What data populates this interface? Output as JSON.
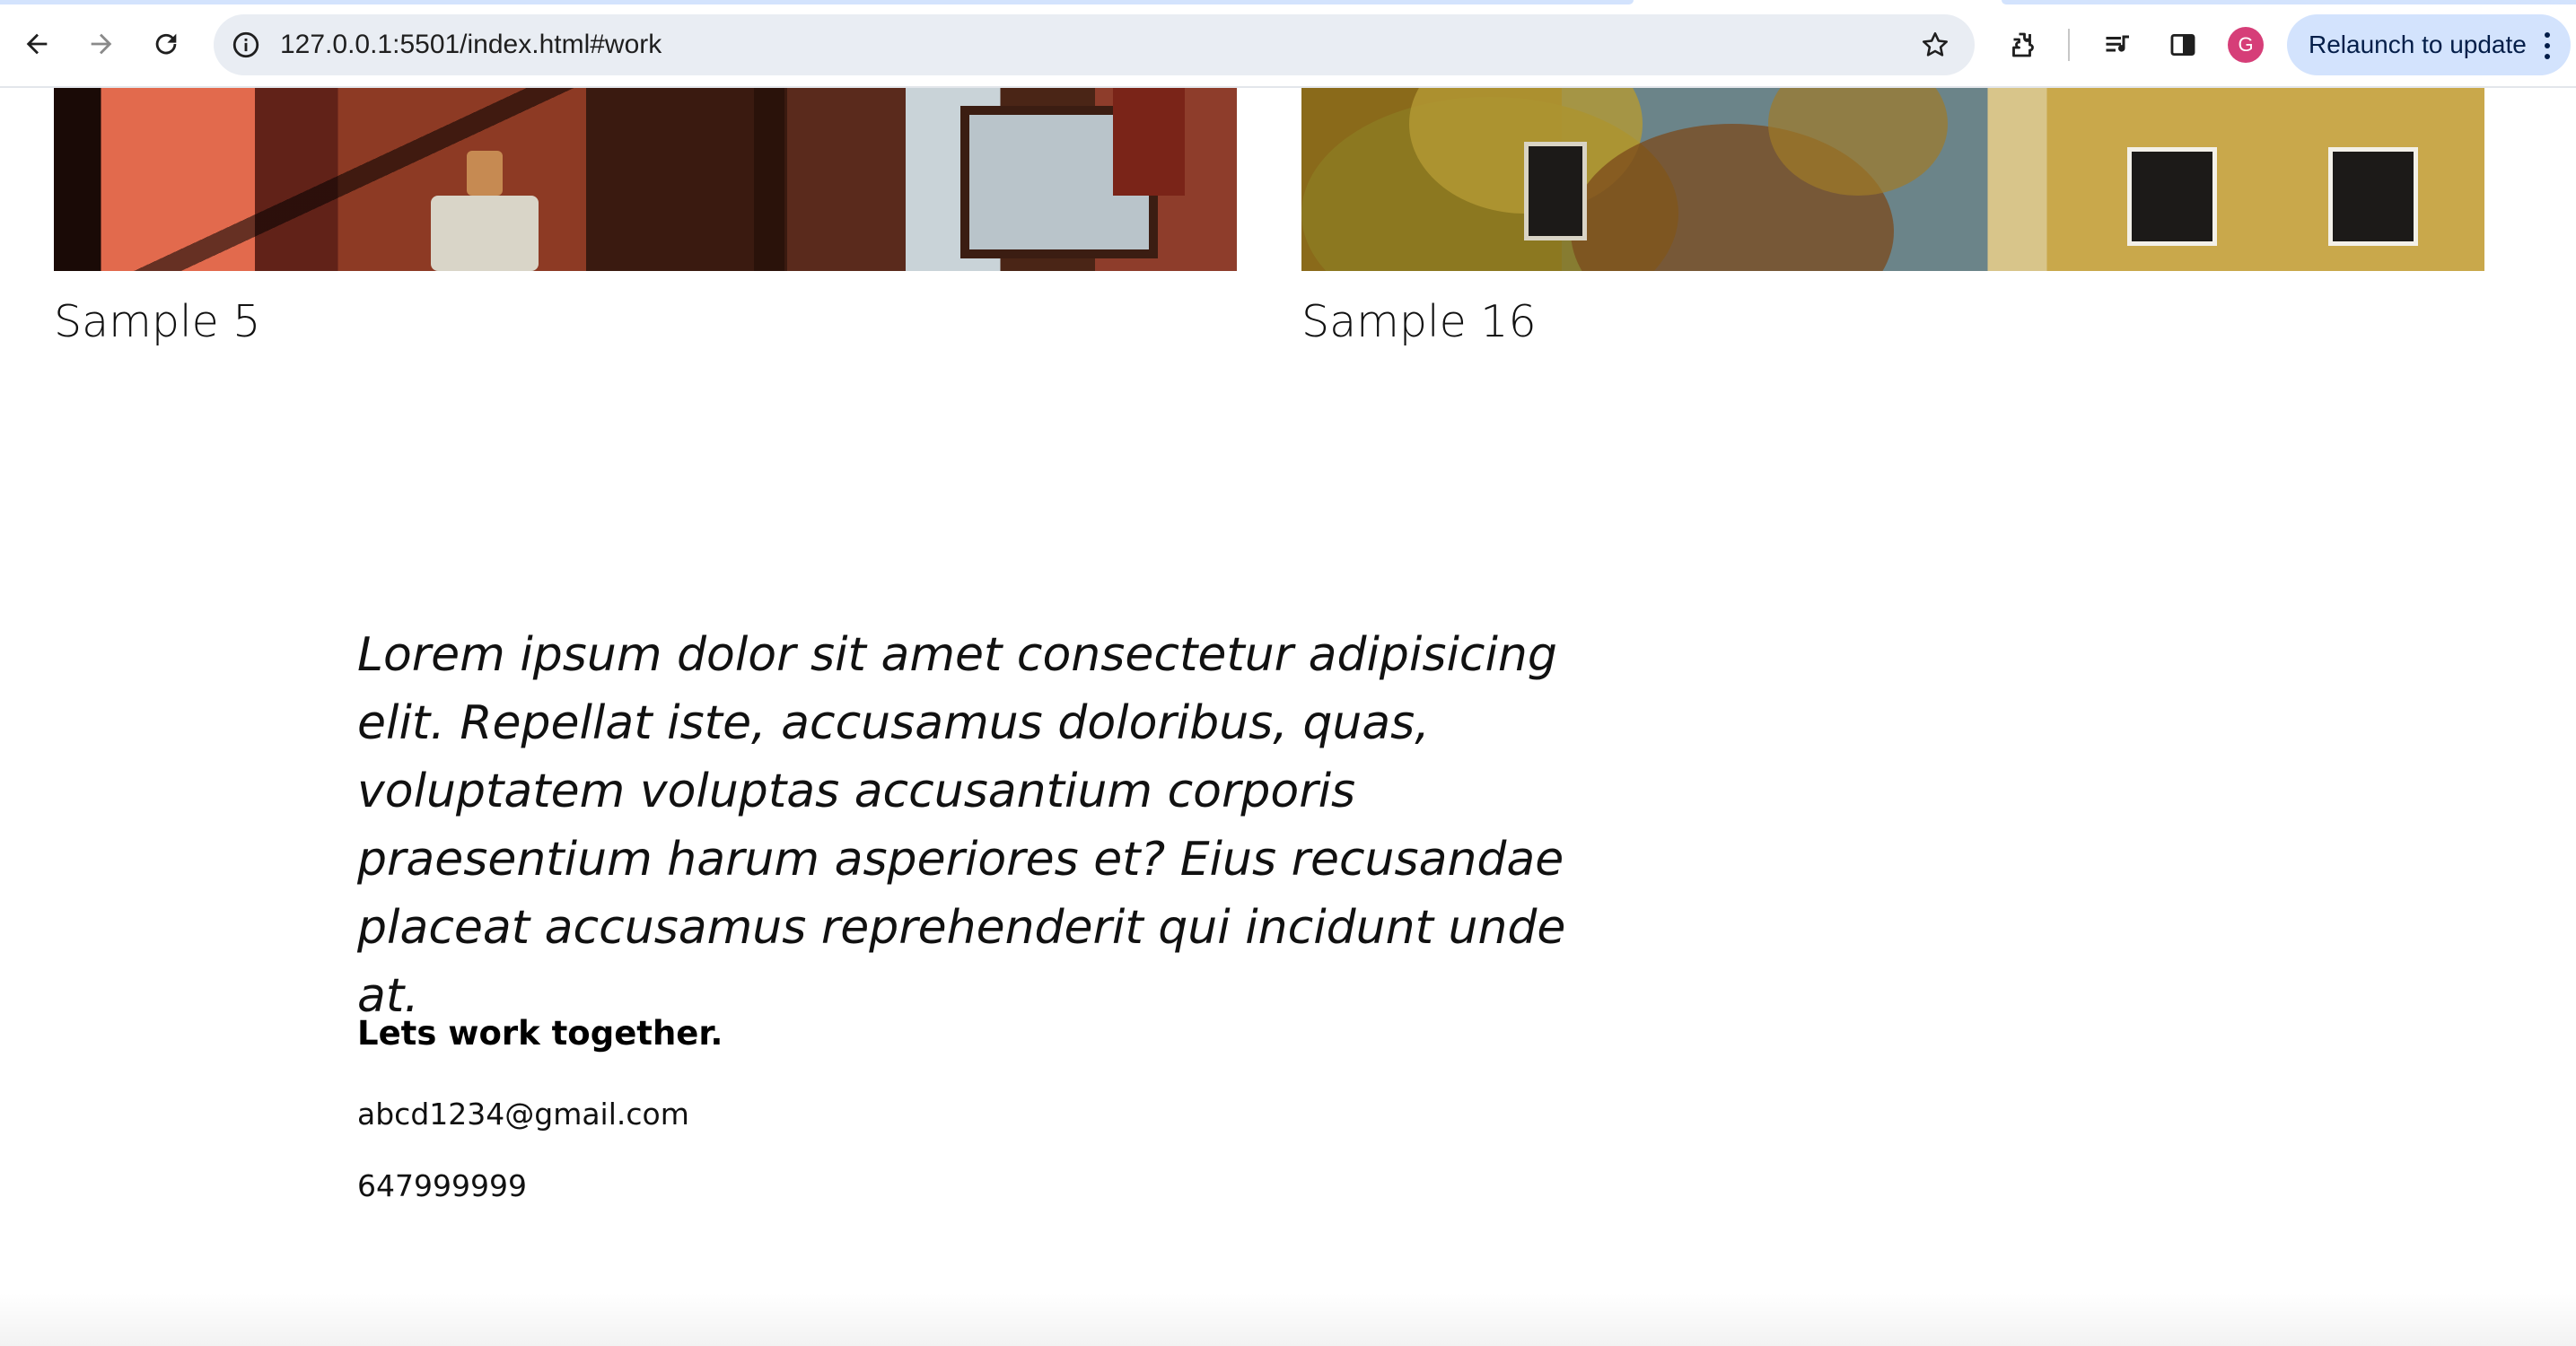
{
  "browser": {
    "url": "127.0.0.1:5501/index.html#work",
    "profile_initial": "G",
    "relaunch_label": "Relaunch to update",
    "accent_color": "#d3e3fd",
    "profile_color": "#d63e78"
  },
  "gallery": {
    "items": [
      {
        "caption": "Sample 5"
      },
      {
        "caption": "Sample 16"
      }
    ]
  },
  "about": {
    "quote": "Lorem ipsum dolor sit amet consectetur adipisicing elit. Repellat iste, accusamus doloribus, quas, voluptatem voluptas accusantium corporis praesentium harum asperiores et? Eius recusandae placeat accusamus reprehenderit qui incidunt unde at.",
    "cta": "Lets work together.",
    "email": "abcd1234@gmail.com",
    "phone": "647999999"
  }
}
